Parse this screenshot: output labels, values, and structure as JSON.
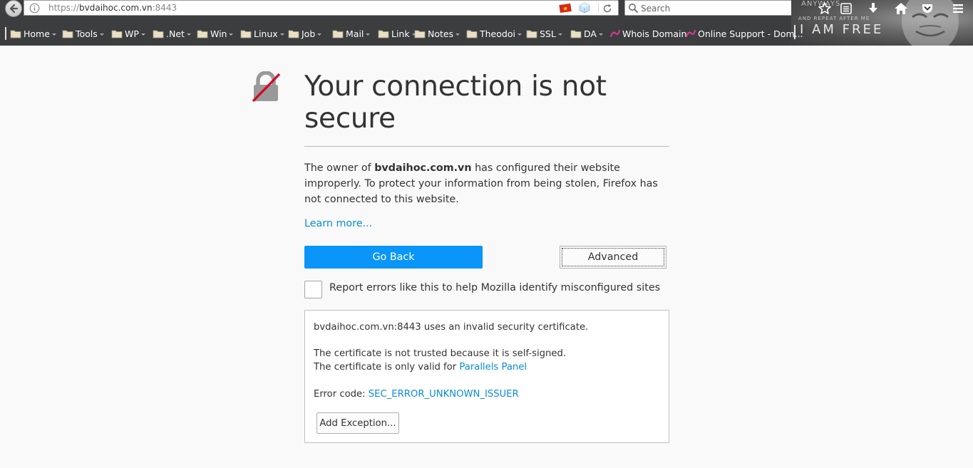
{
  "browser": {
    "url": {
      "scheme": "https://",
      "host": "bvdaihoc.com.vn",
      "port": ":8443"
    },
    "search_placeholder": "Search",
    "theme": {
      "line1": "ANYWAYS",
      "line2": "AND REPEAT AFTER ME",
      "line3": "I AM FREE"
    }
  },
  "bookmarks": [
    {
      "label": "Home",
      "type": "folder"
    },
    {
      "label": "Tools",
      "type": "folder"
    },
    {
      "label": "WP",
      "type": "folder"
    },
    {
      "label": ".Net",
      "type": "folder"
    },
    {
      "label": "Win",
      "type": "folder"
    },
    {
      "label": "Linux",
      "type": "folder"
    },
    {
      "label": "Job",
      "type": "folder"
    },
    {
      "label": "Mail",
      "type": "folder"
    },
    {
      "label": "Link",
      "type": "folder"
    },
    {
      "label": "Notes",
      "type": "folder"
    },
    {
      "label": "Theodoi",
      "type": "folder"
    },
    {
      "label": "SSL",
      "type": "folder"
    },
    {
      "label": "DA",
      "type": "folder"
    },
    {
      "label": "Whois Domain",
      "type": "link"
    },
    {
      "label": "Online Support - Dom...",
      "type": "link"
    }
  ],
  "error": {
    "title": "Your connection is not secure",
    "desc_prefix": "The owner of ",
    "desc_host": "bvdaihoc.com.vn",
    "desc_suffix": " has configured their website improperly. To protect your information from being stolen, Firefox has not connected to this website.",
    "learn_more": "Learn more...",
    "go_back": "Go Back",
    "advanced": "Advanced",
    "report_label": "Report errors like this to help Mozilla identify misconfigured sites",
    "report_checked": false
  },
  "advanced_panel": {
    "line1": "bvdaihoc.com.vn:8443 uses an invalid security certificate.",
    "line2": "The certificate is not trusted because it is self-signed.",
    "line3_prefix": "The certificate is only valid for ",
    "line3_link": "Parallels Panel",
    "error_code_label": "Error code: ",
    "error_code": "SEC_ERROR_UNKNOWN_ISSUER",
    "add_exception": "Add Exception..."
  },
  "colors": {
    "accent": "#0996f8",
    "link": "#0a8dd4",
    "chrome": "#3c3d3f"
  }
}
